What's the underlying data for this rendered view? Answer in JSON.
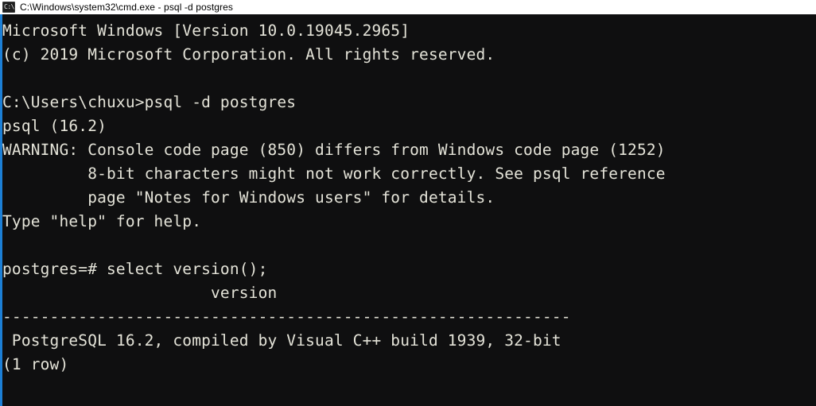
{
  "window": {
    "titlebar": {
      "icon": "cmd-console-icon",
      "icon_glyph": "C:\\",
      "title": "C:\\Windows\\system32\\cmd.exe - psql  -d postgres"
    }
  },
  "colors": {
    "titlebar_bg": "#ffffff",
    "titlebar_text": "#000000",
    "console_bg": "#0f0f10",
    "console_text": "#e4e3d8",
    "accent_border": "#1c7fd6"
  },
  "console": {
    "lines": [
      "Microsoft Windows [Version 10.0.19045.2965]",
      "(c) 2019 Microsoft Corporation. All rights reserved.",
      "",
      "C:\\Users\\chuxu>psql -d postgres",
      "psql (16.2)",
      "WARNING: Console code page (850) differs from Windows code page (1252)",
      "         8-bit characters might not work correctly. See psql reference",
      "         page \"Notes for Windows users\" for details.",
      "Type \"help\" for help.",
      "",
      "postgres=# select version();",
      "                      version",
      "------------------------------------------------------------",
      " PostgreSQL 16.2, compiled by Visual C++ build 1939, 32-bit",
      "(1 row)",
      ""
    ],
    "text": "Microsoft Windows [Version 10.0.19045.2965]\n(c) 2019 Microsoft Corporation. All rights reserved.\n\nC:\\Users\\chuxu>psql -d postgres\npsql (16.2)\nWARNING: Console code page (850) differs from Windows code page (1252)\n         8-bit characters might not work correctly. See psql reference\n         page \"Notes for Windows users\" for details.\nType \"help\" for help.\n\npostgres=# select version();\n                      version\n------------------------------------------------------------\n PostgreSQL 16.2, compiled by Visual C++ build 1939, 32-bit\n(1 row)",
    "prompt": "postgres=#",
    "last_command": "select version();",
    "result_header": "version",
    "result_row": " PostgreSQL 16.2, compiled by Visual C++ build 1939, 32-bit",
    "row_count": "(1 row)",
    "shell_prompt": "C:\\Users\\chuxu>",
    "shell_command": "psql -d postgres",
    "psql_version": "psql (16.2)",
    "os_version": "Microsoft Windows [Version 10.0.19045.2965]",
    "copyright": "(c) 2019 Microsoft Corporation. All rights reserved."
  }
}
